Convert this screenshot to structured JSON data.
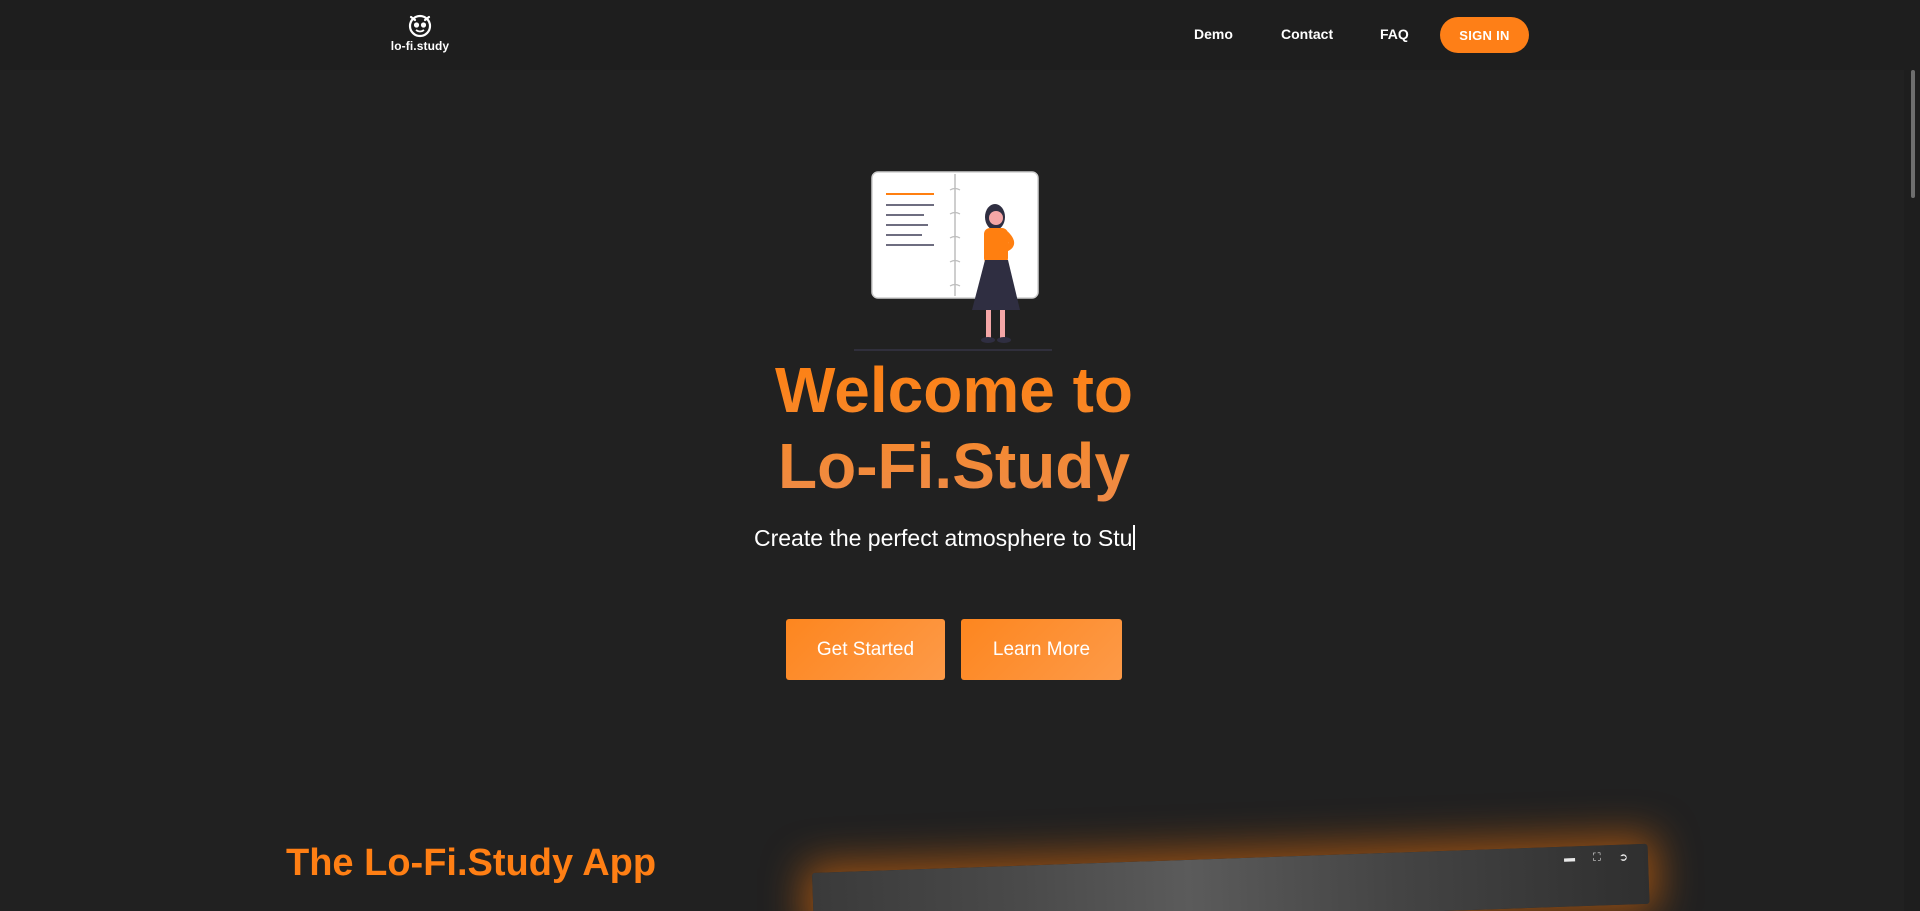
{
  "nav": {
    "logo_text": "lo-fi.study",
    "links": [
      "Demo",
      "Contact",
      "FAQ"
    ],
    "signin_label": "SIGN IN"
  },
  "hero": {
    "title_line1": "Welcome to",
    "title_line2": "Lo-Fi.Study",
    "subtitle": "Create the perfect atmosphere to Stu",
    "get_started_label": "Get Started",
    "learn_more_label": "Learn More"
  },
  "app_section": {
    "title": "The Lo-Fi.Study App"
  },
  "colors": {
    "background": "#212121",
    "accent": "#fe7f17"
  },
  "icons": {
    "logo": "owl-icon",
    "hero": "notebook-woman-illustration",
    "preview_controls": [
      "camera-icon",
      "fullscreen-icon",
      "exit-icon"
    ]
  }
}
